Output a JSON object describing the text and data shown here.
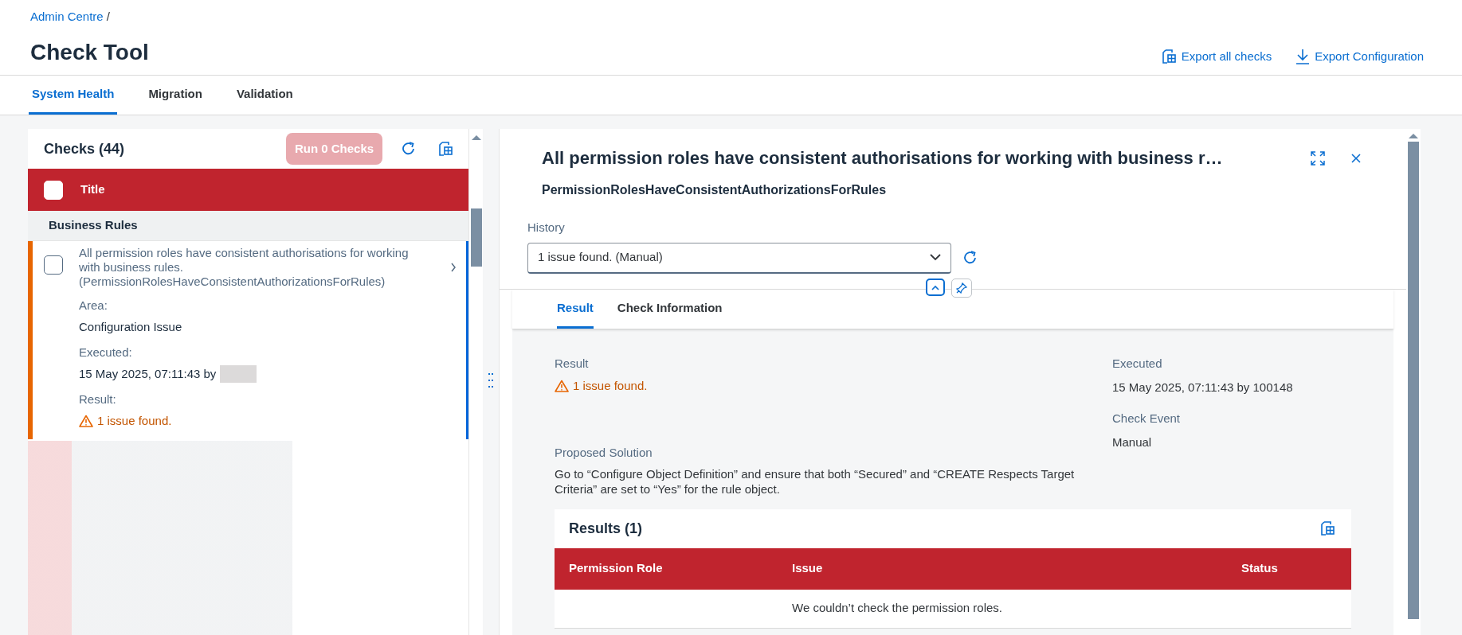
{
  "breadcrumb": {
    "link": "Admin Centre",
    "separator": "/"
  },
  "page_title": "Check Tool",
  "header_actions": [
    {
      "kind": "export",
      "label": "Export all checks"
    },
    {
      "kind": "download",
      "label": "Export Configuration"
    }
  ],
  "tabs": [
    {
      "label": "System Health",
      "selected": true
    },
    {
      "label": "Migration",
      "selected": false
    },
    {
      "label": "Validation",
      "selected": false
    }
  ],
  "checks_panel": {
    "title": "Checks (44)",
    "run_button": {
      "label": "Run 0 Checks",
      "disabled": true
    },
    "table_header": {
      "checked": false,
      "column": "Title"
    },
    "groups": [
      {
        "title": "Business Rules",
        "items": [
          {
            "checked": false,
            "selected": true,
            "title": "All permission roles have consistent authorisations for working with business rules. (PermissionRolesHaveConsistentAuthorizationsForRules)",
            "fields": [
              {
                "label": "Area:",
                "value": "Configuration Issue",
                "kind": "text"
              },
              {
                "label": "Executed:",
                "value": "15 May 2025, 07:11:43 by",
                "kind": "redacted"
              },
              {
                "label": "Result:",
                "value": "1 issue found.",
                "kind": "warning"
              }
            ]
          }
        ]
      }
    ]
  },
  "detail": {
    "title": "All permission roles have consistent authorisations for working with business r…",
    "subtitle": "PermissionRolesHaveConsistentAuthorizationsForRules",
    "history": {
      "label": "History",
      "value": "1 issue found. (Manual)"
    },
    "tabs": [
      {
        "label": "Result",
        "selected": true
      },
      {
        "label": "Check Information",
        "selected": false
      }
    ],
    "result": {
      "label": "Result",
      "value": "1 issue found."
    },
    "executed": {
      "label": "Executed",
      "value": "15 May 2025, 07:11:43 by 100148"
    },
    "check_event": {
      "label": "Check Event",
      "value": "Manual"
    },
    "proposed_solution": {
      "label": "Proposed Solution",
      "value": "Go to “Configure Object Definition” and ensure that both “Secured” and “CREATE Respects Target Criteria” are set to “Yes” for the rule object."
    },
    "results_table": {
      "title": "Results (1)",
      "columns": [
        "Permission Role",
        "Issue",
        "Status"
      ],
      "empty_message": "We couldn’t check the permission roles."
    }
  }
}
